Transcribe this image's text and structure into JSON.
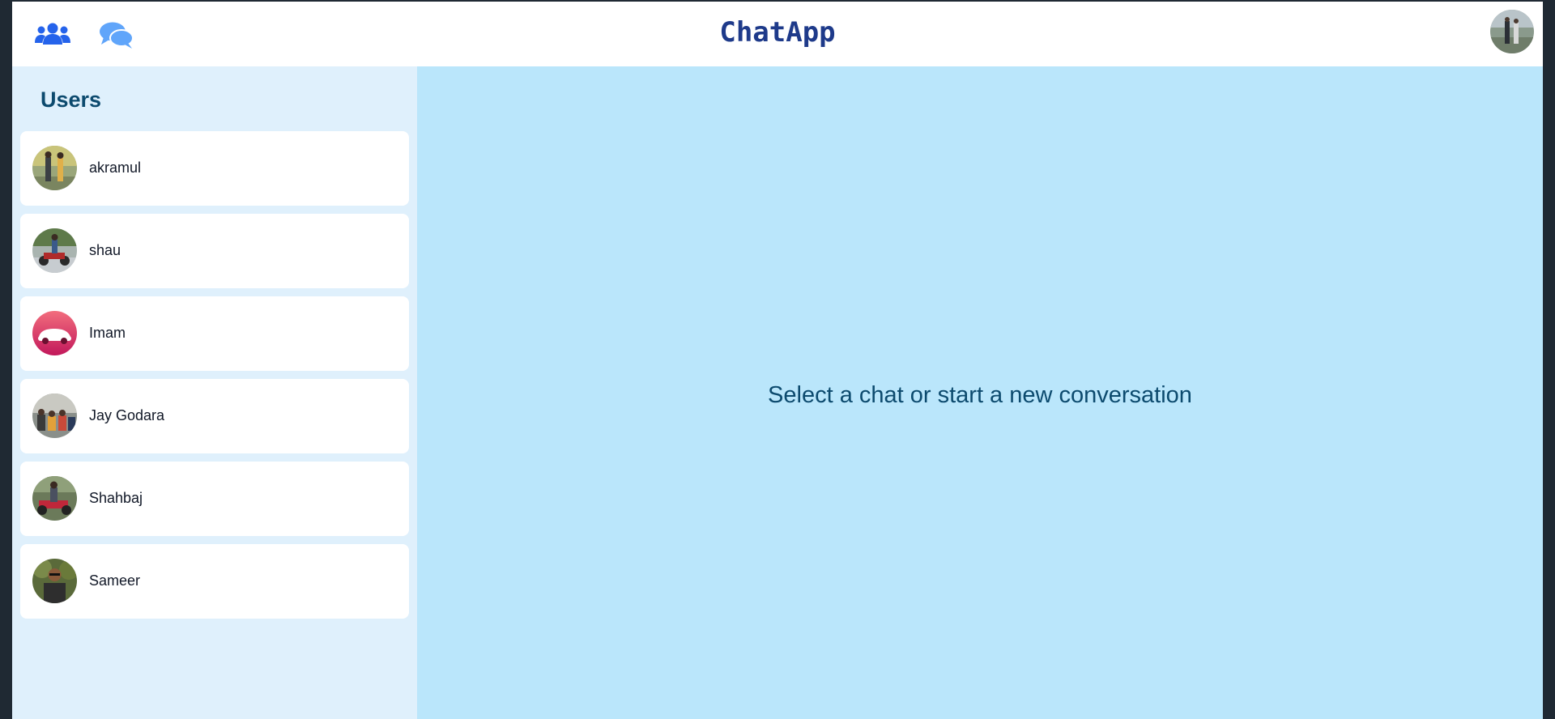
{
  "header": {
    "title": "ChatApp",
    "users_icon": "users-icon",
    "chats_icon": "chat-bubbles-icon",
    "profile_avatar": "user-avatar-photo"
  },
  "sidebar": {
    "title": "Users",
    "users": [
      {
        "name": "akramul",
        "avatar": "photo-two-people"
      },
      {
        "name": "shau",
        "avatar": "photo-motorbike"
      },
      {
        "name": "Imam",
        "avatar": "pink-car"
      },
      {
        "name": "Jay Godara",
        "avatar": "photo-group"
      },
      {
        "name": "Shahbaj",
        "avatar": "photo-motorbike-rider"
      },
      {
        "name": "Sameer",
        "avatar": "photo-person-outdoors"
      }
    ]
  },
  "main": {
    "empty_message": "Select a chat or start a new conversation"
  },
  "colors": {
    "accent": "#2563eb",
    "title": "#1e3a8a",
    "sidebar_bg": "#dff0fc",
    "main_bg": "#bae6fb",
    "heading": "#0c4a6e"
  }
}
